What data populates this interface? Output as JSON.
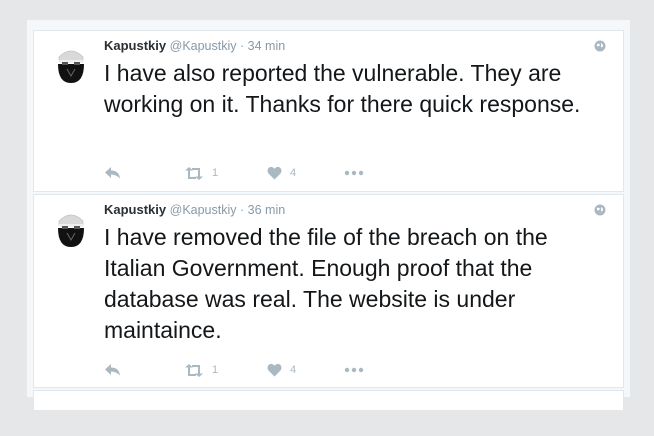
{
  "tweets": [
    {
      "name": "Kapustkiy",
      "handle": "@Kapustkiy",
      "separator": "·",
      "time": "34 min",
      "text": "I have also reported the vulnerable. They are working on it. Thanks for there quick response.",
      "retweets": "1",
      "likes": "4"
    },
    {
      "name": "Kapustkiy",
      "handle": "@Kapustkiy",
      "separator": "·",
      "time": "36 min",
      "text": "I have removed the file of the breach on the Italian Government. Enough proof that the database was real. The website is under maintaince.",
      "retweets": "1",
      "likes": "4"
    }
  ],
  "icons": {
    "reply": "reply-icon",
    "retweet": "retweet-icon",
    "like": "heart-icon",
    "more": "more-icon",
    "location": "globe-icon"
  },
  "colors": {
    "page_bg": "#e6e7e8",
    "card_bg": "#ffffff",
    "border": "#e1e8ed",
    "text": "#14171a",
    "muted": "#8899a6",
    "icon": "#aab8c2"
  }
}
